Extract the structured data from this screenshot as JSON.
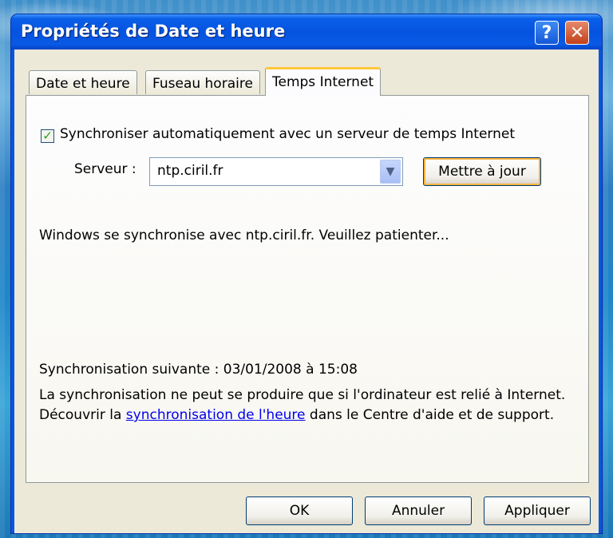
{
  "window": {
    "title": "Propriétés de Date et heure",
    "help_glyph": "?",
    "close_glyph": "✕"
  },
  "tabs": [
    {
      "label": "Date et heure",
      "selected": false
    },
    {
      "label": "Fuseau horaire",
      "selected": false
    },
    {
      "label": "Temps Internet",
      "selected": true
    }
  ],
  "sync": {
    "auto_sync_checked": true,
    "auto_sync_label": "Synchroniser automatiquement avec un serveur de temps Internet",
    "server_label": "Serveur :",
    "server_value": "ntp.ciril.fr",
    "update_button": "Mettre à jour",
    "status_message": "Windows se synchronise avec ntp.ciril.fr. Veuillez patienter...",
    "next_sync": "Synchronisation suivante : 03/01/2008 à 15:08",
    "info_prefix": "La synchronisation ne peut se produire que si l'ordinateur est relié à Internet. Découvrir la ",
    "info_link": "synchronisation de l'heure",
    "info_suffix": " dans le Centre d'aide et de support."
  },
  "buttons": {
    "ok": "OK",
    "cancel": "Annuler",
    "apply": "Appliquer"
  },
  "icons": {
    "check": "✓",
    "dropdown": "▼"
  }
}
